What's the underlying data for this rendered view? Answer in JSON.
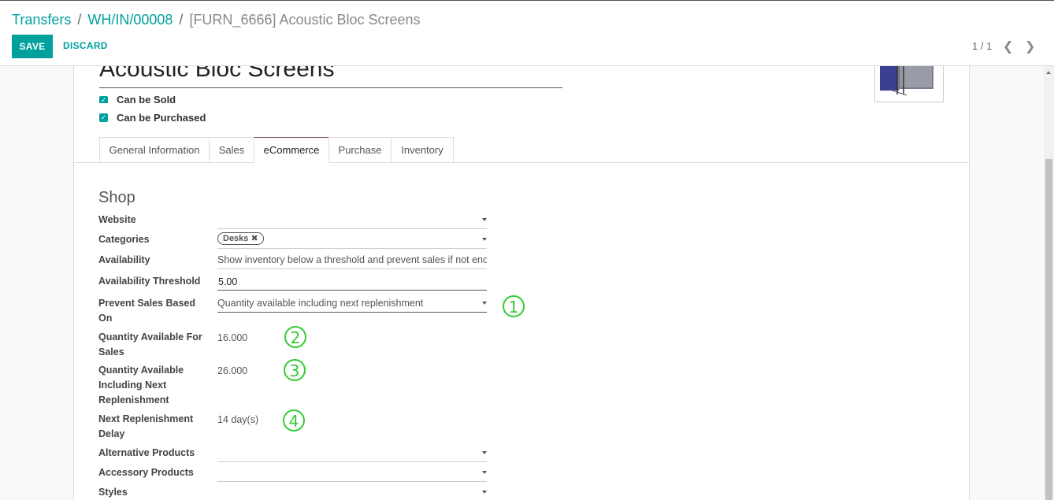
{
  "breadcrumb": {
    "items": [
      "Transfers",
      "WH/IN/00008",
      "[FURN_6666] Acoustic Bloc Screens"
    ],
    "separator": "/"
  },
  "toolbar": {
    "save_label": "SAVE",
    "discard_label": "DISCARD"
  },
  "pager": {
    "value": "1 / 1",
    "prev_icon": "chevron-left-icon",
    "next_icon": "chevron-right-icon"
  },
  "product": {
    "name": "Acoustic Bloc Screens",
    "can_be_sold_label": "Can be Sold",
    "can_be_purchased_label": "Can be Purchased"
  },
  "tabs": [
    {
      "label": "General Information",
      "active": false
    },
    {
      "label": "Sales",
      "active": false
    },
    {
      "label": "eCommerce",
      "active": true
    },
    {
      "label": "Purchase",
      "active": false
    },
    {
      "label": "Inventory",
      "active": false
    }
  ],
  "shop": {
    "section_title": "Shop",
    "website_label": "Website",
    "categories_label": "Categories",
    "categories_tag": "Desks",
    "availability_label": "Availability",
    "availability_value": "Show inventory below a threshold and prevent sales if not enough stock",
    "threshold_label": "Availability Threshold",
    "threshold_value": "5.00",
    "prevent_label": "Prevent Sales Based On",
    "prevent_value": "Quantity available including next replenishment",
    "qty_sales_label": "Quantity Available For Sales",
    "qty_sales_value": "16.000",
    "qty_repl_label": "Quantity Available Including Next Replenishment",
    "qty_repl_value": "26.000",
    "delay_label": "Next Replenishment Delay",
    "delay_value": "14 day(s)",
    "alternative_label": "Alternative Products",
    "accessory_label": "Accessory Products",
    "styles_label": "Styles"
  },
  "annotations": [
    "1",
    "2",
    "3",
    "4"
  ],
  "colors": {
    "accent": "#00a09d",
    "annotation": "#33cc33",
    "active_tab": "#7c4a6b"
  }
}
